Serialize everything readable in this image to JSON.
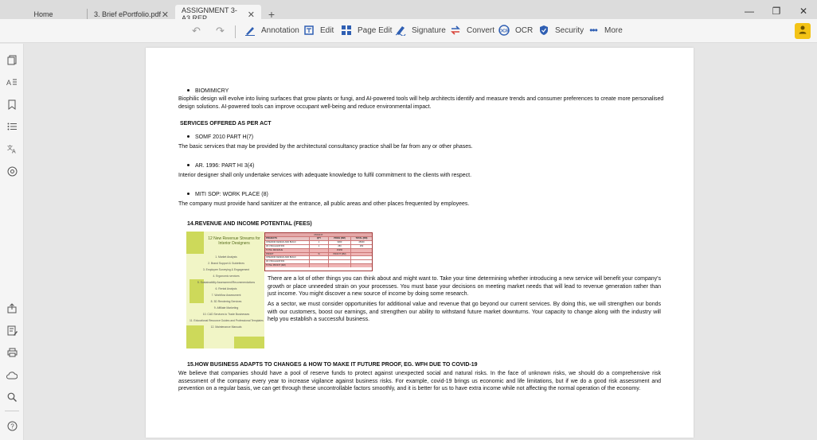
{
  "tabs": [
    {
      "label": "Home"
    },
    {
      "label": "3. Brief ePortfolio.pdf"
    },
    {
      "label": "ASSIGNMENT 3- A3 REP..."
    }
  ],
  "toolbar": {
    "annotation": "Annotation",
    "edit": "Edit",
    "page_edit": "Page Edit",
    "signature": "Signature",
    "convert": "Convert",
    "ocr": "OCR",
    "security": "Security",
    "more": "More"
  },
  "doc": {
    "biomimicry_title": "BIOMIMICRY",
    "biomimicry_line1": "Biophilic design will evolve into living surfaces that grow plants or fungi, and AI-powered tools will help architects identify and measure trends and consumer preferences to create more personalised",
    "biomimicry_line2": "design solutions. AI-powered tools can improve occupant well-being and reduce environmental impact.",
    "services_heading": "SERVICES OFFERED AS PER ACT",
    "somf_title": "SOMF 2010 PART H(7)",
    "somf_text": "The basic services that may be provided by the architectural consultancy practice shall be far from any or other phases.",
    "ar_title": "AR. 1996: PART HI 3(4)",
    "ar_text": "Interior designer shall only undertake services with adequate knowledge to fulfil commitment to the clients with respect.",
    "miti_title": "MITI SOP: WORK PLACE (8)",
    "miti_text": "The company must provide hand sanitizer at the entrance, all public areas and other places frequented by employees.",
    "revenue_heading": "14.REVENUE AND INCOME POTENTIAL (FEES)",
    "revenue_para1": "There are a lot of other things you can think about and might want to. Take your time determining whether introducing a new service will benefit your company's growth or place unneeded strain on your processes. You must base your decisions on meeting market needs that will lead to revenue generation rather than just income. You might discover a new source of income by doing some research.",
    "revenue_para2": "As a sector, we must consider opportunities for additional value and revenue that go beyond our current services. By doing this, we will strengthen our bonds with our customers, boost our earnings, and strengthen our ability to withstand future market downturns. Your capacity to change along with the industry will help you establish a successful business.",
    "covid_heading": "15.HOW BUSINESS ADAPTS TO CHANGES & HOW TO MAKE IT FUTURE PROOF, EG. WFH DUE TO COVID-19",
    "covid_para": "We believe that companies should have a pool of reserve funds to protect against unexpected social and natural risks. In the face of unknown risks, we should do a comprehensive risk assessment of the company every year to increase vigilance against business risks. For example, covid-19 brings us economic and life limitations, but if we do a good risk assessment and prevention on a regular basis, we can get through these uncontrollable factors smoothly, and it is better for us to have extra income while not affecting the normal operation of the economy."
  },
  "infographic": {
    "title": "12 New Revenue Streams for Interior Designers",
    "items": [
      "1. Market Analysis",
      "2. Brand Support & Guidelines",
      "3. Employee Surveying & Engagement",
      "4. Ergonomic services",
      "5. Sustainability Assessment/Recommendations",
      "6. Rental Analysis",
      "7. Workflow Assessment",
      "8. 3D Rendering Services",
      "9. Affiliate Marketing",
      "10. CAD Services to Trade Businesses",
      "11. Educational Resource Guides and Professional Templates",
      "12. Maintenance Manuals"
    ]
  },
  "fee_table": {
    "title": "PROFIT",
    "headers": [
      "PROJECTS",
      "QTY",
      "PRICE (RM)",
      "TOTAL (RM)"
    ],
    "rows": [
      [
        "INTERIOR DESIGN AND BUILD",
        "1",
        "9000",
        "45000"
      ],
      [
        "3D VISUALIZATION",
        "1",
        "250",
        "250"
      ],
      [
        "TOTAL REVENUE",
        "",
        "45250",
        ""
      ],
      [
        "PROFIT",
        "%",
        "PROFIT (RM)",
        ""
      ],
      [
        "INTERIOR DESIGN AND BUILD",
        "",
        "",
        ""
      ],
      [
        "3D VISUALIZATION",
        "",
        "",
        ""
      ],
      [
        "TOTAL PROFIT (RM)",
        "",
        "",
        ""
      ]
    ]
  },
  "colors": {
    "accent_blue": "#2f5fb3",
    "avatar_yellow": "#f3c316",
    "infographic_green": "#cdd95a",
    "table_red": "#a23a3a"
  }
}
